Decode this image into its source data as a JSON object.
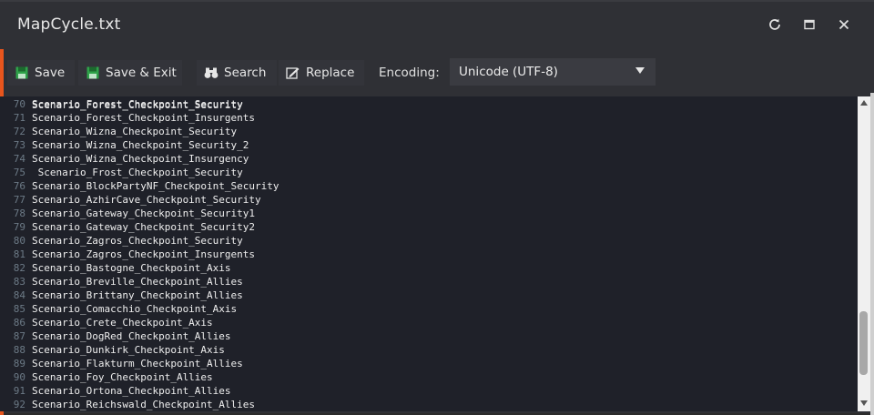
{
  "window": {
    "title": "MapCycle.txt",
    "controls": [
      "refresh-icon",
      "maximize-icon",
      "close-icon"
    ]
  },
  "toolbar": {
    "save_label": "Save",
    "save_exit_label": "Save & Exit",
    "search_label": "Search",
    "replace_label": "Replace",
    "encoding_label": "Encoding:",
    "encoding_value": "Unicode (UTF-8)"
  },
  "editor": {
    "partial_top_line": "Scenario_Forest_Checkpoint_Security",
    "lines": [
      {
        "n": "70",
        "text": "Scenario_Forest_Checkpoint_Security"
      },
      {
        "n": "71",
        "text": "Scenario_Forest_Checkpoint_Insurgents"
      },
      {
        "n": "72",
        "text": "Scenario_Wizna_Checkpoint_Security"
      },
      {
        "n": "73",
        "text": "Scenario_Wizna_Checkpoint_Security_2"
      },
      {
        "n": "74",
        "text": "Scenario_Wizna_Checkpoint_Insurgency"
      },
      {
        "n": "75",
        "text": " Scenario_Frost_Checkpoint_Security"
      },
      {
        "n": "76",
        "text": "Scenario_BlockPartyNF_Checkpoint_Security"
      },
      {
        "n": "77",
        "text": "Scenario_AzhirCave_Checkpoint_Security"
      },
      {
        "n": "78",
        "text": "Scenario_Gateway_Checkpoint_Security1"
      },
      {
        "n": "79",
        "text": "Scenario_Gateway_Checkpoint_Security2"
      },
      {
        "n": "80",
        "text": "Scenario_Zagros_Checkpoint_Security"
      },
      {
        "n": "81",
        "text": "Scenario_Zagros_Checkpoint_Insurgents"
      },
      {
        "n": "82",
        "text": "Scenario_Bastogne_Checkpoint_Axis"
      },
      {
        "n": "83",
        "text": "Scenario_Breville_Checkpoint_Allies"
      },
      {
        "n": "84",
        "text": "Scenario_Brittany_Checkpoint_Allies"
      },
      {
        "n": "85",
        "text": "Scenario_Comacchio_Checkpoint_Axis"
      },
      {
        "n": "86",
        "text": "Scenario_Crete_Checkpoint_Axis"
      },
      {
        "n": "87",
        "text": "Scenario_DogRed_Checkpoint_Allies"
      },
      {
        "n": "88",
        "text": "Scenario_Dunkirk_Checkpoint_Axis"
      },
      {
        "n": "89",
        "text": "Scenario_Flakturm_Checkpoint_Allies"
      },
      {
        "n": "90",
        "text": "Scenario_Foy_Checkpoint_Allies"
      },
      {
        "n": "91",
        "text": "Scenario_Ortona_Checkpoint_Allies"
      },
      {
        "n": "92",
        "text": "Scenario_Reichswald_Checkpoint_Allies"
      }
    ]
  },
  "colors": {
    "accent": "#e8551d",
    "editor_bg": "#1f2129",
    "line_number": "#6c7a86",
    "text": "#eeeeee",
    "save_icon": "#2fa34a"
  }
}
